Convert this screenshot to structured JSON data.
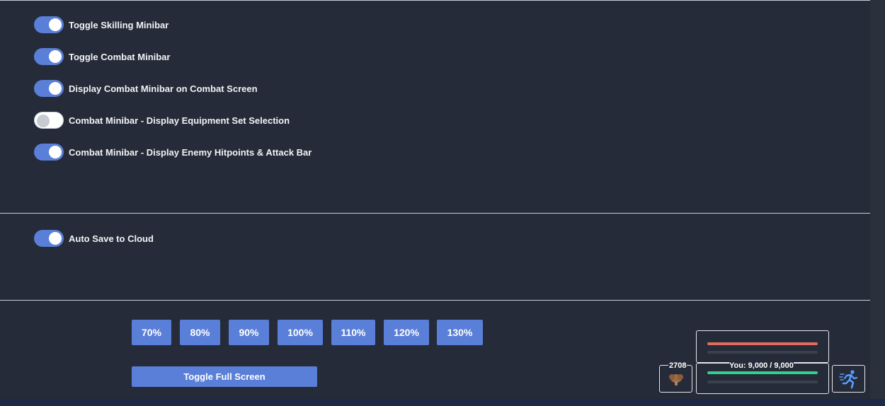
{
  "minibar_settings": [
    {
      "label": "Toggle Skilling Minibar",
      "enabled": true
    },
    {
      "label": "Toggle Combat Minibar",
      "enabled": true
    },
    {
      "label": "Display Combat Minibar on Combat Screen",
      "enabled": true
    },
    {
      "label": "Combat Minibar - Display Equipment Set Selection",
      "enabled": false
    },
    {
      "label": "Combat Minibar - Display Enemy Hitpoints & Attack Bar",
      "enabled": true
    }
  ],
  "cloud_settings": [
    {
      "label": "Auto Save to Cloud",
      "enabled": true
    }
  ],
  "zoom_levels": [
    "70%",
    "80%",
    "90%",
    "100%",
    "110%",
    "120%",
    "130%"
  ],
  "fullscreen_label": "Toggle Full Screen",
  "combat_minibar": {
    "food_count": "2708",
    "player_hp_text": "You: 9,000 / 9,000",
    "enemy_hp_fraction": 1.0,
    "player_hp_fraction": 1.0,
    "colors": {
      "enemy_hp": "#e06c5e",
      "player_hp": "#2fd18b",
      "accent": "#5a7fd8"
    }
  }
}
